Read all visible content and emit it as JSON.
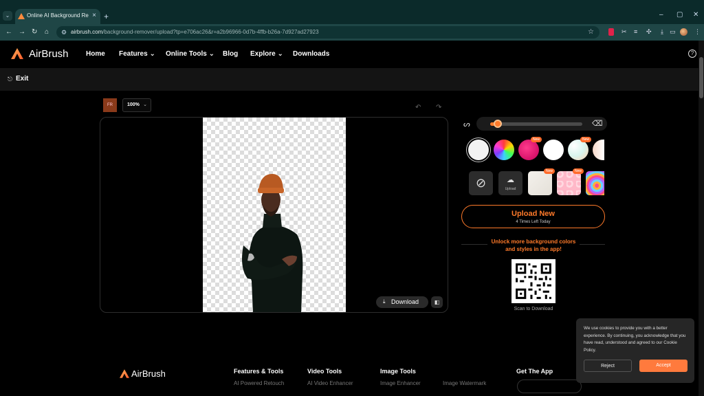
{
  "browser": {
    "tab_title": "Online AI Background Remover",
    "tab_close": "×",
    "new_tab": "+",
    "url_host": "airbrush.com",
    "url_path": "/background-remover/upload?tp=e706ac26&r=a2b96966-0d7b-4ffb-b26a-7d927ad27923"
  },
  "site": {
    "brand": "AirBrush",
    "nav": [
      {
        "label": "Home",
        "has_caret": false
      },
      {
        "label": "Features",
        "has_caret": true
      },
      {
        "label": "Online Tools",
        "has_caret": true
      },
      {
        "label": "Blog",
        "has_caret": false
      },
      {
        "label": "Explore",
        "has_caret": true
      },
      {
        "label": "Downloads",
        "has_caret": false
      }
    ],
    "help": "?",
    "exit_label": "Exit"
  },
  "editor": {
    "avatar_text": "FR",
    "zoom": "100%",
    "download_label": "Download",
    "slider_value": 0.08,
    "upload_new_title": "Upload New",
    "upload_new_sub": "4 Times Left Today",
    "unlock_line1": "Unlock more background colors",
    "unlock_line2": "and styles in the app!",
    "scan_caption": "Scan to Download",
    "upload_tile_label": "Upload",
    "new_badge": "New",
    "accent_color": "#ff7a2a"
  },
  "footer": {
    "brand": "AirBrush",
    "columns": [
      {
        "title": "Features & Tools",
        "links": [
          "AI Powered Retouch"
        ]
      },
      {
        "title": "Video Tools",
        "links": [
          "AI Video Enhancer"
        ]
      },
      {
        "title": "Image Tools",
        "links": [
          "Image Enhancer",
          "Image Watermark"
        ]
      },
      {
        "title": "Get The App",
        "links": []
      }
    ]
  },
  "cookie": {
    "text": "We use cookies to provide you with a better experience. By continuing, you acknowledge that you have read, understood and agreed to our Cookie Policy.",
    "reject": "Reject",
    "accept": "Accept"
  }
}
